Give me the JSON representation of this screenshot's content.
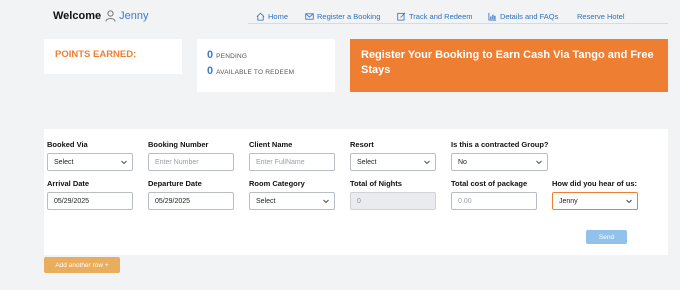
{
  "header": {
    "welcome_label": "Welcome",
    "username": "Jenny",
    "nav": [
      {
        "label": "Home",
        "icon": "home-icon"
      },
      {
        "label": "Register a Booking",
        "icon": "envelope-icon"
      },
      {
        "label": "Track and Redeem",
        "icon": "edit-icon"
      },
      {
        "label": "Details and FAQs",
        "icon": "chart-icon"
      },
      {
        "label": "Reserve Hotel",
        "icon": ""
      }
    ]
  },
  "points": {
    "title": "POINTS EARNED:",
    "pending_value": "0",
    "pending_label": "PENDING",
    "available_value": "0",
    "available_label": "AVAILABLE TO REDEEM"
  },
  "banner": {
    "text": "Register Your Booking to Earn Cash Via Tango and Free Stays"
  },
  "form": {
    "row1": [
      {
        "label": "Booked Via",
        "value": "Select",
        "type": "select"
      },
      {
        "label": "Booking Number",
        "value": "",
        "placeholder": "Enter Number",
        "type": "input"
      },
      {
        "label": "Client Name",
        "value": "",
        "placeholder": "Enter FullName",
        "type": "input"
      },
      {
        "label": "Resort",
        "value": "Select",
        "type": "select"
      },
      {
        "label": "Is this a contracted Group?",
        "value": "No",
        "type": "select"
      }
    ],
    "row2": [
      {
        "label": "Arrival Date",
        "value": "05/29/2025",
        "type": "input"
      },
      {
        "label": "Departure Date",
        "value": "05/29/2025",
        "type": "input"
      },
      {
        "label": "Room Category",
        "value": "Select",
        "type": "select"
      },
      {
        "label": "Total of Nights",
        "value": "0",
        "type": "disabled"
      },
      {
        "label": "Total cost of package",
        "value": "",
        "placeholder": "0.00",
        "type": "input"
      },
      {
        "label": "How did you hear of us:",
        "value": "Jenny",
        "type": "select"
      }
    ],
    "send_label": "Send",
    "add_row_label": "Add another row +"
  },
  "colors": {
    "accent_orange": "#ee7f32",
    "link_blue": "#2c6fbb",
    "send_blue": "#90c2ec",
    "add_row_orange": "#e9ad5e"
  }
}
